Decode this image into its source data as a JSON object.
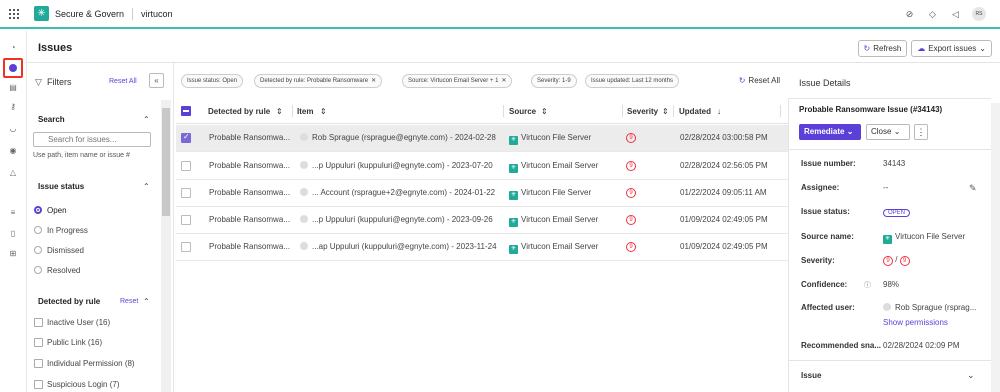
{
  "app": {
    "name": "Secure & Govern",
    "workspace": "virtucon",
    "avatar": "RS"
  },
  "page": {
    "title": "Issues",
    "refresh_label": "Refresh",
    "export_label": "Export issues"
  },
  "filters": {
    "title": "Filters",
    "reset_all": "Reset All",
    "search": {
      "title": "Search",
      "placeholder": "Search for issues...",
      "hint": "Use path, item name or issue #"
    },
    "status": {
      "title": "Issue status",
      "options": [
        "Open",
        "In Progress",
        "Dismissed",
        "Resolved"
      ],
      "selected": "Open"
    },
    "rule": {
      "title": "Detected by rule",
      "reset": "Reset",
      "options": [
        "Inactive User (16)",
        "Public Link (16)",
        "Individual Permission (8)",
        "Suspicious Login (7)"
      ]
    }
  },
  "chips": [
    "Issue status: Open",
    "Detected by rule: Probable Ransomware",
    "Source: Virtucon Email Server + 1",
    "Severity: 1-9",
    "Issue updated: Last 12 months"
  ],
  "chips_reset": "Reset All",
  "table": {
    "columns": [
      "Detected by rule",
      "Item",
      "Source",
      "Severity",
      "Updated"
    ],
    "rows": [
      {
        "rule": "Probable Ransomwa...",
        "item": "Rob Sprague (rsprague@egnyte.com) - 2024-02-28",
        "source": "Virtucon File Server",
        "severity": "9",
        "updated": "02/28/2024 03:00:58 PM",
        "selected": true
      },
      {
        "rule": "Probable Ransomwa...",
        "item": "...p Uppuluri (kuppuluri@egnyte.com) - 2023-07-20",
        "source": "Virtucon Email Server",
        "severity": "9",
        "updated": "02/28/2024 02:56:05 PM",
        "selected": false
      },
      {
        "rule": "Probable Ransomwa...",
        "item": "... Account (rsprague+2@egnyte.com) - 2024-01-22",
        "source": "Virtucon File Server",
        "severity": "9",
        "updated": "01/22/2024 09:05:11 AM",
        "selected": false
      },
      {
        "rule": "Probable Ransomwa...",
        "item": "...p Uppuluri (kuppuluri@egnyte.com) - 2023-09-26",
        "source": "Virtucon Email Server",
        "severity": "9",
        "updated": "01/09/2024 02:49:05 PM",
        "selected": false
      },
      {
        "rule": "Probable Ransomwa...",
        "item": "...ap Uppuluri (kuppuluri@egnyte.com) - 2023-11-24",
        "source": "Virtucon Email Server",
        "severity": "9",
        "updated": "01/09/2024 02:49:05 PM",
        "selected": false
      }
    ]
  },
  "details": {
    "title": "Issue Details",
    "issue_title": "Probable Ransomware Issue (#34143)",
    "remediate_label": "Remediate",
    "close_label": "Close",
    "fields": {
      "issue_number_label": "Issue number:",
      "issue_number": "34143",
      "assignee_label": "Assignee:",
      "assignee": "--",
      "status_label": "Issue status:",
      "status": "OPEN",
      "source_label": "Source name:",
      "source": "Virtucon File Server",
      "severity_label": "Severity:",
      "severity_a": "9",
      "severity_b": "9",
      "confidence_label": "Confidence:",
      "confidence": "98%",
      "affected_label": "Affected user:",
      "affected": "Rob Sprague (rsprag...",
      "show_permissions": "Show permissions",
      "recommended_label": "Recommended sna...",
      "recommended": "02/28/2024 02:09 PM"
    },
    "section": "Issue"
  }
}
